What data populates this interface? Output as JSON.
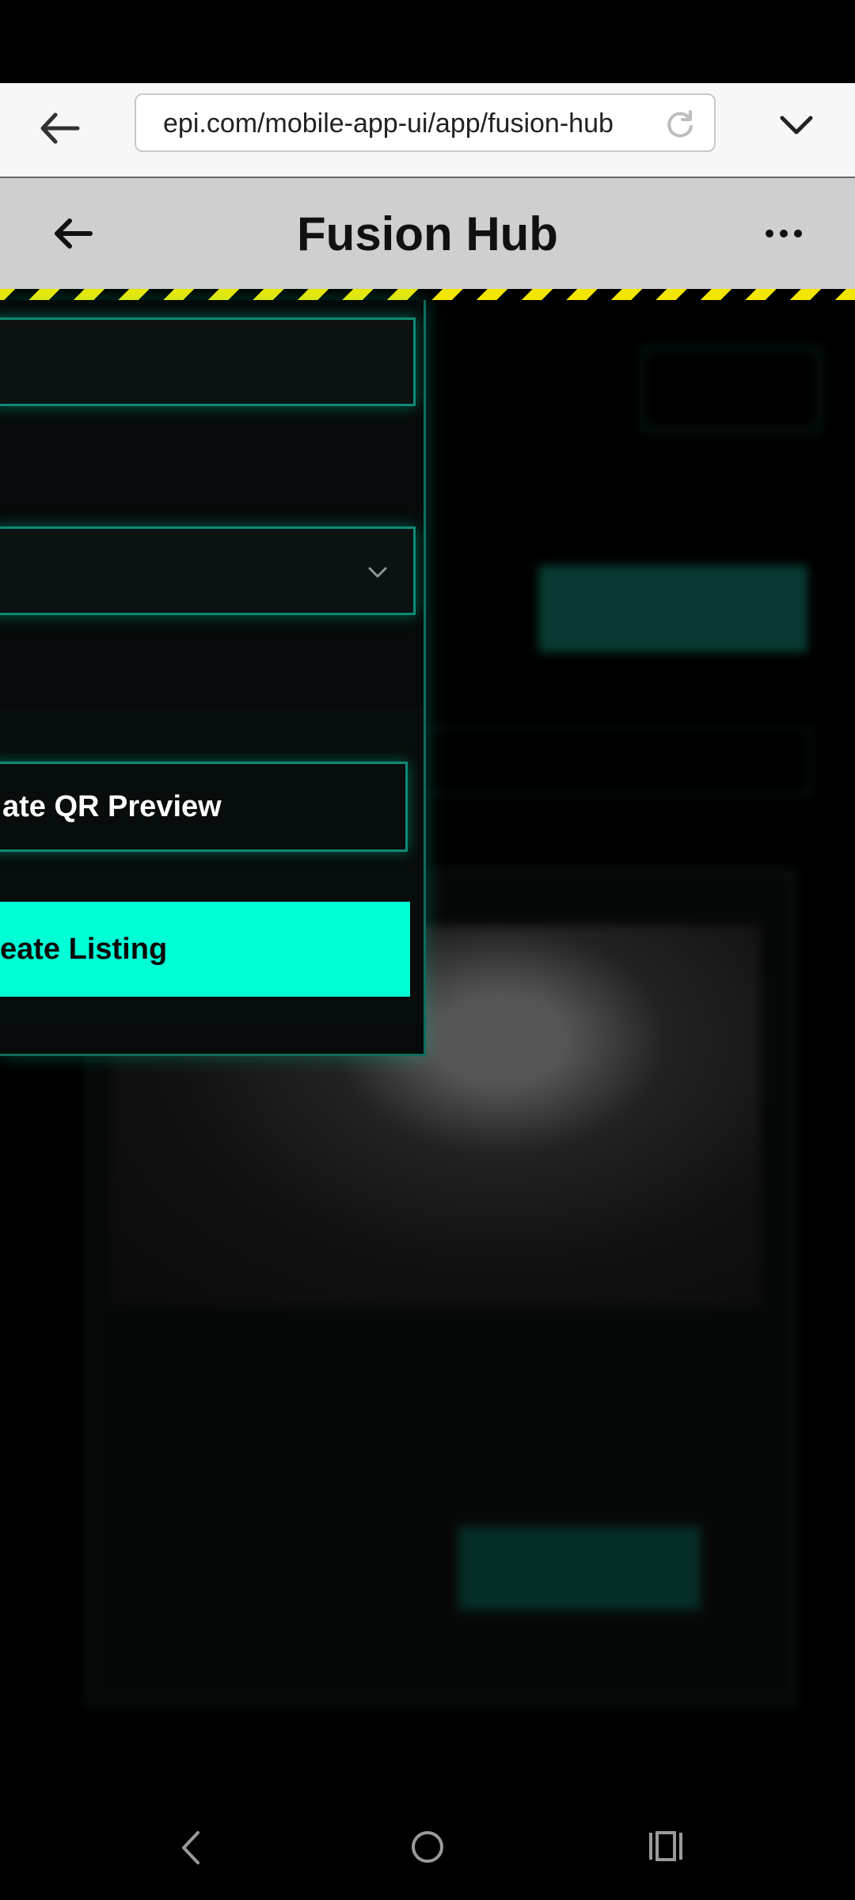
{
  "browser": {
    "url": "epi.com/mobile-app-ui/app/fusion-hub",
    "back_icon": "arrow-left-icon",
    "reload_icon": "reload-icon",
    "menu_icon": "chevron-down-icon"
  },
  "header": {
    "title": "Fusion Hub",
    "back_icon": "arrow-left-icon",
    "more_icon": "more-horizontal-icon"
  },
  "modal": {
    "qr_button_label": "ate QR Preview",
    "create_button_label": "eate Listing",
    "select_icon": "chevron-down-icon"
  },
  "colors": {
    "accent": "#00ffd5",
    "header_bg": "#cfcfcf",
    "hazard_yellow": "#f2e600"
  },
  "nav": {
    "back_icon": "nav-back-icon",
    "home_icon": "nav-home-icon",
    "recent_icon": "nav-recent-apps-icon"
  }
}
